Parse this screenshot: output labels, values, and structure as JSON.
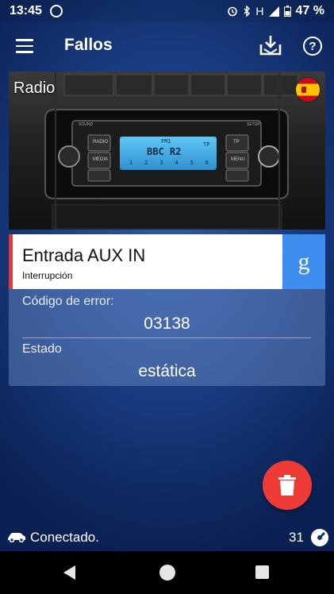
{
  "status_bar": {
    "time": "13:45",
    "network": "H",
    "battery": "47 %",
    "icons": [
      "whatsapp-icon",
      "alarm-icon",
      "bluetooth-icon",
      "signal-icon",
      "battery-icon"
    ]
  },
  "appbar": {
    "title": "Fallos",
    "icons": [
      "menu-icon",
      "download-icon",
      "help-icon"
    ]
  },
  "module": {
    "title": "Radio",
    "language_flag": "spain-flag-icon",
    "display": {
      "band": "FM1",
      "station": "BBC R2",
      "presets": [
        "1",
        "2",
        "3",
        "4",
        "5",
        "6"
      ],
      "tp": "TP",
      "left_buttons": [
        "RADIO",
        "MEDIA"
      ],
      "right_buttons": [
        "TP",
        "MENU"
      ],
      "top_labels": [
        "SOUND",
        "SETUP"
      ]
    }
  },
  "error": {
    "title": "Entrada AUX IN",
    "subtitle": "Interrupción",
    "google_label": "g",
    "code_label": "Código de error:",
    "code_value": "03138",
    "state_label": "Estado",
    "state_value": "estática"
  },
  "footer": {
    "connection": "Conectado.",
    "count": "31"
  },
  "colors": {
    "accent_red": "#ef3b36",
    "google_blue": "#3d8ef0",
    "error_bar": "#e53935"
  }
}
